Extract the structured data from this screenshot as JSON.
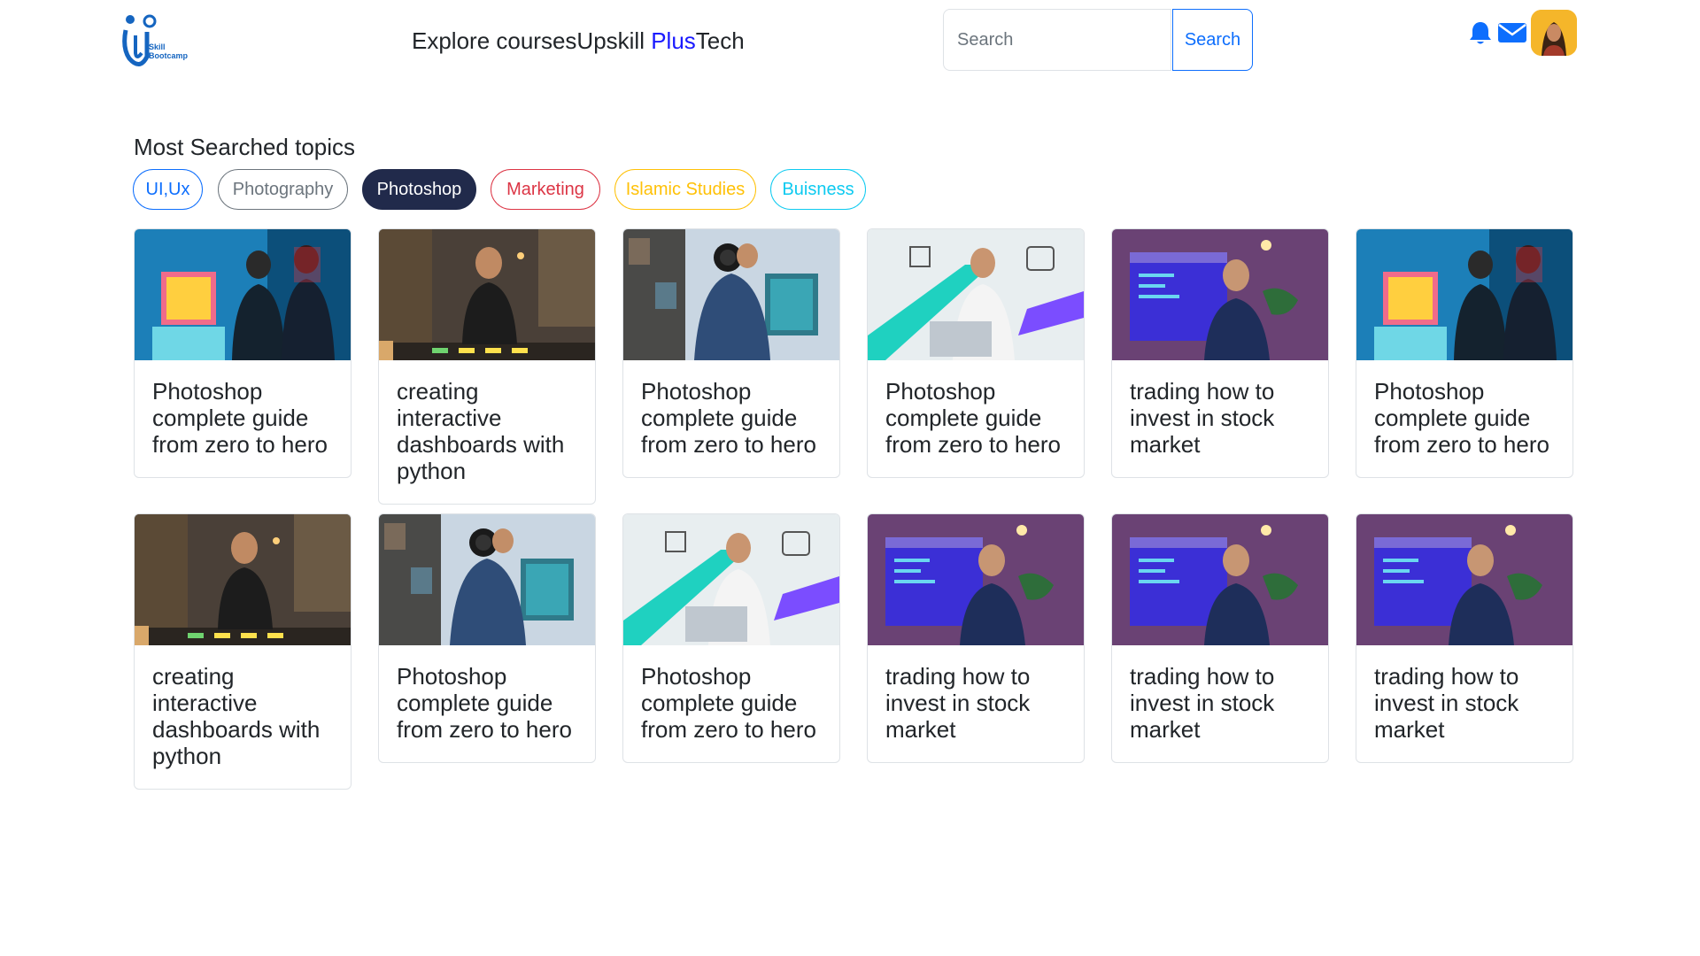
{
  "header": {
    "logo_text_line1": "Skill",
    "logo_text_line2": "Bootcamp",
    "nav_part1": "Explore courses",
    "nav_part2": "Upskill ",
    "nav_part3": "Plus",
    "nav_part4": "Tech",
    "search_placeholder": "Search",
    "search_button": "Search",
    "accent_color": "#0d6efd"
  },
  "topics": {
    "title": "Most Searched topics",
    "items": [
      {
        "label": "UI,Ux",
        "color": "#0d6efd",
        "active": false
      },
      {
        "label": "Photography",
        "color": "#6c757d",
        "active": false
      },
      {
        "label": "Photoshop",
        "color": "#212a4b",
        "active": true
      },
      {
        "label": "Marketing",
        "color": "#dc3545",
        "active": false
      },
      {
        "label": "Islamic Studies",
        "color": "#ffc107",
        "active": false
      },
      {
        "label": "Buisness",
        "color": "#0dcaf0",
        "active": false
      }
    ]
  },
  "courses": [
    {
      "title": "Photoshop complete guide from zero to hero",
      "thumb": "photoshop-duo"
    },
    {
      "title": "creating interactive dashboards with python",
      "thumb": "presenter-room"
    },
    {
      "title": "Photoshop complete guide from zero to hero",
      "thumb": "photographer"
    },
    {
      "title": "Photoshop complete guide from zero to hero",
      "thumb": "laptop-man"
    },
    {
      "title": "trading how to invest in stock market",
      "thumb": "trader"
    },
    {
      "title": "Photoshop complete guide from zero to hero",
      "thumb": "photoshop-duo"
    },
    {
      "title": "creating interactive dashboards with python",
      "thumb": "presenter-room"
    },
    {
      "title": "Photoshop complete guide from zero to hero",
      "thumb": "photographer"
    },
    {
      "title": "Photoshop complete guide from zero to hero",
      "thumb": "laptop-man"
    },
    {
      "title": "trading how to invest in stock market",
      "thumb": "trader"
    },
    {
      "title": "trading how to invest in stock market",
      "thumb": "trader"
    },
    {
      "title": "trading how to invest in stock market",
      "thumb": "trader"
    }
  ]
}
